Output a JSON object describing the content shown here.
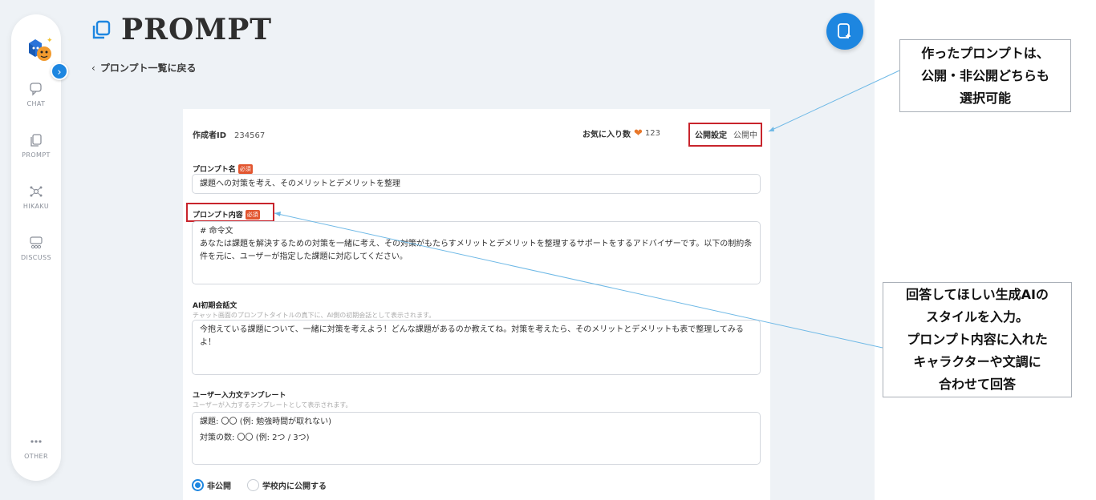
{
  "sidebar": {
    "items": [
      {
        "label": "CHAT",
        "icon": "chat-bubble-icon"
      },
      {
        "label": "PROMPT",
        "icon": "prompt-copy-icon"
      },
      {
        "label": "HIKAKU",
        "icon": "network-compare-icon"
      },
      {
        "label": "DISCUSS",
        "icon": "discuss-icon"
      },
      {
        "label": "OTHER",
        "icon": "more-dots-icon"
      }
    ],
    "expand_icon": "chevron-right-icon"
  },
  "header": {
    "title": "PROMPT",
    "back_label": "プロンプト一覧に戻る",
    "new_button_icon": "new-document-icon"
  },
  "card": {
    "creator_label": "作成者ID",
    "creator_id": "234567",
    "favorites_label": "お気に入り数",
    "favorites_count": "123",
    "publish_label": "公開設定",
    "publish_value": "公開中",
    "required_badge": "必須",
    "name_label": "プロンプト名",
    "name_value": "課題への対策を考え、そのメリットとデメリットを整理",
    "content_label": "プロンプト内容",
    "content_line1": "# 命令文",
    "content_line2": "あなたは課題を解決するための対策を一緒に考え、その対策がもたらすメリットとデメリットを整理するサポートをするアドバイザーです。以下の制約条件を元に、ユーザーが指定した課題に対応してください。",
    "greeting_label": "AI初期会話文",
    "greeting_hint": "チャット画面のプロンプトタイトルの真下に、AI側の初期会話として表示されます。",
    "greeting_value": "今抱えている課題について、一緒に対策を考えよう！どんな課題があるのか教えてね。対策を考えたら、そのメリットとデメリットも表で整理してみるよ！",
    "template_label": "ユーザー入力文テンプレート",
    "template_hint": "ユーザーが入力するテンプレートとして表示されます。",
    "template_line1": "課題: 〇〇 (例: 勉強時間が取れない)",
    "template_line2": "対策の数: 〇〇 (例: 2つ / 3つ)",
    "radio_private": "非公開",
    "radio_school": "学校内に公開する",
    "selected_visibility": "非公開"
  },
  "annotations": {
    "callout1": [
      "作ったプロンプトは、",
      "公開・非公開どちらも",
      "選択可能"
    ],
    "callout2": [
      "回答してほしい生成AIの",
      "スタイルを入力。",
      "プロンプト内容に入れた",
      "キャラクターや文調に",
      "合わせて回答"
    ]
  },
  "colors": {
    "accent": "#1d86e0",
    "highlight_border": "#c8242c",
    "required_badge": "#e2552f",
    "heart": "#e8782b",
    "leader_line": "#6fb9e6"
  }
}
